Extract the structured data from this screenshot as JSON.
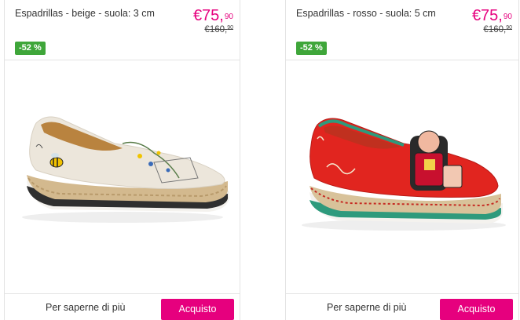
{
  "products": [
    {
      "title": "Espadrillas - beige - suola: 3 cm",
      "price_now_main": "€75,",
      "price_now_cents": "90",
      "price_was_main": "€160,",
      "price_was_cents": "90",
      "discount_badge": "-52 %",
      "more_link": "Per saperne di più",
      "buy_label": "Acquisto",
      "colors": {
        "upper": "#ece6db",
        "sole": "#d3b98e",
        "stripe": "#1a1a1a"
      }
    },
    {
      "title": "Espadrillas - rosso - suola: 5 cm",
      "price_now_main": "€75,",
      "price_now_cents": "90",
      "price_was_main": "€160,",
      "price_was_cents": "90",
      "discount_badge": "-52 %",
      "more_link": "Per saperne di più",
      "buy_label": "Acquisto",
      "colors": {
        "upper": "#e1251f",
        "sole": "#d8c29a",
        "stripe": "#2e9a7c"
      }
    }
  ],
  "theme": {
    "accent": "#e6007e",
    "badge": "#3fa63a"
  }
}
